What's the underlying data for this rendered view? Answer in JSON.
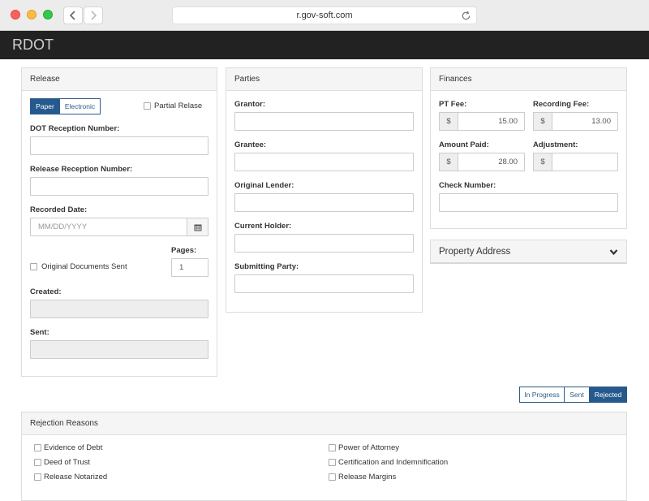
{
  "browser": {
    "url": "r.gov-soft.com"
  },
  "app": {
    "brand": "RDOT"
  },
  "release": {
    "title": "Release",
    "type_options": [
      "Paper",
      "Electronic"
    ],
    "partial_label": "Partial Relase",
    "dot_reception_label": "DOT Reception Number:",
    "release_reception_label": "Release Reception Number:",
    "recorded_date_label": "Recorded Date:",
    "recorded_date_placeholder": "MM/DD/YYYY",
    "pages_label": "Pages:",
    "pages_value": "1",
    "original_docs_label": "Original Documents Sent",
    "created_label": "Created:",
    "sent_label": "Sent:"
  },
  "parties": {
    "title": "Parties",
    "fields": [
      "Grantor:",
      "Grantee:",
      "Original Lender:",
      "Current Holder:",
      "Submitting Party:"
    ]
  },
  "finances": {
    "title": "Finances",
    "currency_symbol": "$",
    "pt_fee_label": "PT Fee:",
    "pt_fee_value": "15.00",
    "recording_fee_label": "Recording Fee:",
    "recording_fee_value": "13.00",
    "amount_paid_label": "Amount Paid:",
    "amount_paid_value": "28.00",
    "adjustment_label": "Adjustment:",
    "adjustment_value": "",
    "check_number_label": "Check Number:"
  },
  "property_address": {
    "title": "Property Address"
  },
  "status": {
    "options": [
      "In Progress",
      "Sent",
      "Rejected"
    ],
    "selected": "Rejected"
  },
  "rejection": {
    "title": "Rejection Reasons",
    "left": [
      "Evidence of Debt",
      "Deed of Trust",
      "Release Notarized"
    ],
    "right": [
      "Power of Attorney",
      "Certification and Indemnification",
      "Release Margins"
    ]
  },
  "colors": {
    "primary": "#245a8d",
    "header_bg": "#222222"
  },
  "icons": {
    "calendar": "calendar-icon",
    "chevron": "chevron-down-icon"
  }
}
